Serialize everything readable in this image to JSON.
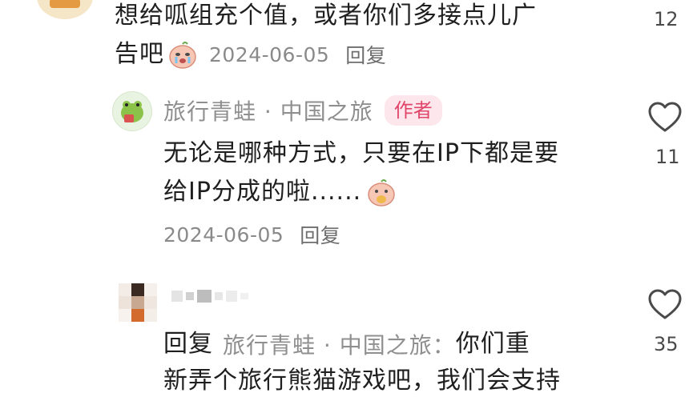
{
  "comment1": {
    "text_line1": "想给呱组充个值，或者你们多接点儿广",
    "text_line2": "告吧",
    "emoji_icon": "crying-bun-emoji-icon",
    "date": "2024-06-05",
    "reply_label": "回复",
    "likes": "12"
  },
  "reply1": {
    "author": "旅行青蛙 · 中国之旅",
    "badge": "作者",
    "text_line1": "无论是哪种方式，只要在IP下都是要",
    "text_line2": "给IP分成的啦......",
    "emoji_icon": "eating-bun-emoji-icon",
    "date": "2024-06-05",
    "reply_label": "回复",
    "likes": "11"
  },
  "reply2": {
    "reply_prefix": "回复",
    "reply_to": "旅行青蛙 · 中国之旅：",
    "text_line1_rest": "你们重",
    "text_line2": "新弄个旅行熊猫游戏吧，我们会支持",
    "likes": "35"
  },
  "colors": {
    "badge_bg": "#fde7ec",
    "badge_text": "#e0456a",
    "meta_gray": "#8a8a8a"
  }
}
